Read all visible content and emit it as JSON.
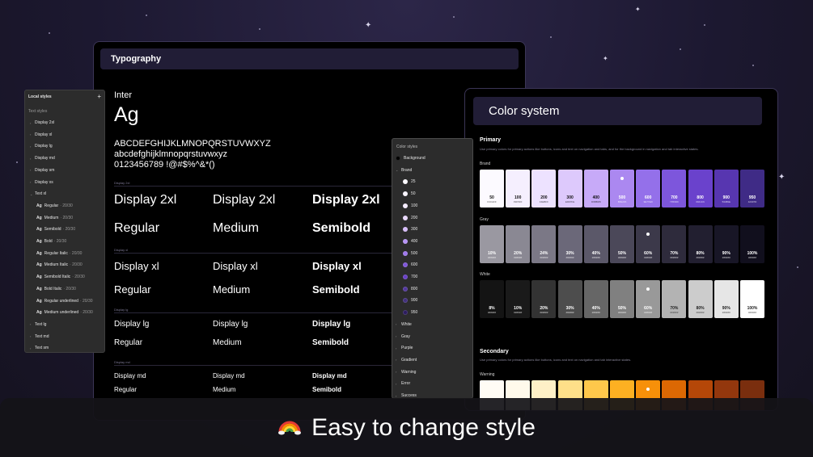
{
  "colors": {
    "bg": "#1c1830",
    "panel": "#2c2c2c",
    "header": "#211d36",
    "accent": "#6e47d9"
  },
  "typography": {
    "title": "Typography",
    "font_name": "Inter",
    "sample": "Ag",
    "charset": [
      "ABCDEFGHIJKLMNOPQRSTUVWXYZ",
      "abcdefghijklmnopqrstuvwxyz",
      "0123456789 !@#$%^&*()"
    ],
    "sections": [
      {
        "label": "Display 2xl",
        "name": "Display 2xl",
        "weights": [
          "Regular",
          "Medium",
          "Semibold"
        ]
      },
      {
        "label": "Display xl",
        "name": "Display xl",
        "weights": [
          "Regular",
          "Medium",
          "Semibold"
        ]
      },
      {
        "label": "Display lg",
        "name": "Display lg",
        "weights": [
          "Regular",
          "Medium",
          "Semibold"
        ]
      },
      {
        "label": "Display md",
        "name": "Display md",
        "weights": [
          "Regular",
          "Medium",
          "Semibold"
        ]
      }
    ]
  },
  "local_styles": {
    "title": "Local styles",
    "group": "Text styles",
    "top_items": [
      "Display 2xl",
      "Display xl",
      "Display lg",
      "Display md",
      "Display sm",
      "Display xs"
    ],
    "expanded": "Text xl",
    "sample": "Ag",
    "styles": [
      {
        "name": "Regular",
        "size": "· 20/30"
      },
      {
        "name": "Medium",
        "size": "· 20/30"
      },
      {
        "name": "Semibold",
        "size": "· 20/30"
      },
      {
        "name": "Bold",
        "size": "· 20/30"
      },
      {
        "name": "Regular Italic",
        "size": "· 20/30"
      },
      {
        "name": "Medium Italic",
        "size": "· 20/30"
      },
      {
        "name": "Semibold Italic",
        "size": "· 20/30"
      },
      {
        "name": "Bold Italic",
        "size": "· 20/30"
      },
      {
        "name": "Regular underlined",
        "size": "· 20/30"
      },
      {
        "name": "Medium underlined",
        "size": "· 20/30"
      }
    ],
    "bottom_items": [
      "Text lg",
      "Text md",
      "Text sm"
    ]
  },
  "color_styles": {
    "title": "Color styles",
    "items": [
      {
        "label": "Background",
        "color": "#000000",
        "type": "swatch"
      },
      {
        "label": "Brand",
        "type": "group-open"
      },
      {
        "label": "25",
        "color": "#fcfaff",
        "type": "child"
      },
      {
        "label": "50",
        "color": "#f9f5ff",
        "type": "child"
      },
      {
        "label": "100",
        "color": "#f4ebff",
        "type": "child"
      },
      {
        "label": "200",
        "color": "#e9d7fe",
        "type": "child"
      },
      {
        "label": "300",
        "color": "#d6bbfb",
        "type": "child"
      },
      {
        "label": "400",
        "color": "#b692f6",
        "type": "child"
      },
      {
        "label": "500",
        "color": "#9e77ed",
        "type": "child"
      },
      {
        "label": "600",
        "color": "#7f56d9",
        "type": "child"
      },
      {
        "label": "700",
        "color": "#6941c6",
        "type": "child"
      },
      {
        "label": "800",
        "color": "#53389e",
        "type": "child"
      },
      {
        "label": "900",
        "color": "#42307d",
        "type": "child"
      },
      {
        "label": "950",
        "color": "#2c1c5f",
        "type": "child"
      },
      {
        "label": "White",
        "type": "group"
      },
      {
        "label": "Gray",
        "type": "group"
      },
      {
        "label": "Purple",
        "type": "group"
      },
      {
        "label": "Gradient",
        "type": "group"
      },
      {
        "label": "Warning",
        "type": "group"
      },
      {
        "label": "Error",
        "type": "group"
      },
      {
        "label": "Success",
        "type": "group"
      },
      {
        "label": "Blue gray",
        "type": "group"
      }
    ]
  },
  "color_system": {
    "title": "Color system",
    "primary": {
      "title": "Primary",
      "desc": "Use primary colors for primary actions like buttons, icons and text on navigation and tabs, and for the background in navigation and tab interactive states."
    },
    "secondary": {
      "title": "Secondary",
      "desc": "Use primary colors for primary actions like buttons, icons and text on navigation and tab interactive states."
    },
    "brand": {
      "label": "Brand",
      "swatches": [
        {
          "n": "50",
          "hex": "FCFAFF",
          "bg": "#fcfaff",
          "fg": "#111"
        },
        {
          "n": "100",
          "hex": "F9F5FF",
          "bg": "#f5effe",
          "fg": "#111"
        },
        {
          "n": "200",
          "hex": "F4EBFF",
          "bg": "#ede2ff",
          "fg": "#111"
        },
        {
          "n": "300",
          "hex": "E9D7FE",
          "bg": "#ddc9fc",
          "fg": "#111"
        },
        {
          "n": "400",
          "hex": "D6BBFB",
          "bg": "#c7aaf8",
          "fg": "#111"
        },
        {
          "n": "500",
          "hex": "B692F6",
          "bg": "#ab88f0",
          "fg": "#fff",
          "mark": true
        },
        {
          "n": "600",
          "hex": "9E77ED",
          "bg": "#9470ea",
          "fg": "#fff"
        },
        {
          "n": "700",
          "hex": "7F56D9",
          "bg": "#7d56dc",
          "fg": "#fff"
        },
        {
          "n": "800",
          "hex": "6941C6",
          "bg": "#6a42cc",
          "fg": "#fff"
        },
        {
          "n": "900",
          "hex": "53389E",
          "bg": "#5736b0",
          "fg": "#fff"
        },
        {
          "n": "950",
          "hex": "42307D",
          "bg": "#3f2b86",
          "fg": "#fff"
        }
      ]
    },
    "gray": {
      "label": "Gray",
      "swatches": [
        {
          "n": "10%",
          "hex": "######",
          "bg": "#9a98a1",
          "fg": "#fff"
        },
        {
          "n": "20%",
          "hex": "######",
          "bg": "#8a8893",
          "fg": "#fff"
        },
        {
          "n": "24%",
          "hex": "######",
          "bg": "#7b7886",
          "fg": "#fff"
        },
        {
          "n": "30%",
          "hex": "######",
          "bg": "#6b6879",
          "fg": "#fff"
        },
        {
          "n": "40%",
          "hex": "######",
          "bg": "#5b5869",
          "fg": "#fff"
        },
        {
          "n": "50%",
          "hex": "######",
          "bg": "#4b4859",
          "fg": "#fff"
        },
        {
          "n": "60%",
          "hex": "######",
          "bg": "#3c394a",
          "fg": "#fff",
          "mark": true
        },
        {
          "n": "70%",
          "hex": "######",
          "bg": "#2e2b3c",
          "fg": "#fff"
        },
        {
          "n": "80%",
          "hex": "######",
          "bg": "#221f30",
          "fg": "#fff"
        },
        {
          "n": "90%",
          "hex": "######",
          "bg": "#181626",
          "fg": "#fff"
        },
        {
          "n": "100%",
          "hex": "######",
          "bg": "#110f1d",
          "fg": "#fff"
        }
      ]
    },
    "white": {
      "label": "White",
      "swatches": [
        {
          "n": "8%",
          "hex": "######",
          "bg": "#141414",
          "fg": "#fff"
        },
        {
          "n": "10%",
          "hex": "######",
          "bg": "#1a1a1a",
          "fg": "#fff"
        },
        {
          "n": "20%",
          "hex": "######",
          "bg": "#333333",
          "fg": "#fff"
        },
        {
          "n": "30%",
          "hex": "######",
          "bg": "#4d4d4d",
          "fg": "#fff"
        },
        {
          "n": "40%",
          "hex": "######",
          "bg": "#666666",
          "fg": "#fff"
        },
        {
          "n": "50%",
          "hex": "######",
          "bg": "#808080",
          "fg": "#fff"
        },
        {
          "n": "60%",
          "hex": "######",
          "bg": "#999999",
          "fg": "#fff",
          "mark": true
        },
        {
          "n": "70%",
          "hex": "######",
          "bg": "#b3b3b3",
          "fg": "#222"
        },
        {
          "n": "80%",
          "hex": "######",
          "bg": "#cccccc",
          "fg": "#222"
        },
        {
          "n": "90%",
          "hex": "######",
          "bg": "#e6e6e6",
          "fg": "#222"
        },
        {
          "n": "100%",
          "hex": "######",
          "bg": "#ffffff",
          "fg": "#222"
        }
      ]
    },
    "warning": {
      "label": "Warning",
      "swatches": [
        {
          "bg": "#fffcf5"
        },
        {
          "bg": "#fffaeb"
        },
        {
          "bg": "#fef0c7"
        },
        {
          "bg": "#fedf89"
        },
        {
          "bg": "#fec84b"
        },
        {
          "bg": "#fdb022"
        },
        {
          "bg": "#f79009",
          "mark": true
        },
        {
          "bg": "#dc6803"
        },
        {
          "bg": "#b54708"
        },
        {
          "bg": "#93370d"
        },
        {
          "bg": "#7a2e0e"
        }
      ]
    }
  },
  "banner": {
    "icon": "rainbow-icon",
    "text": "Easy to change style"
  }
}
